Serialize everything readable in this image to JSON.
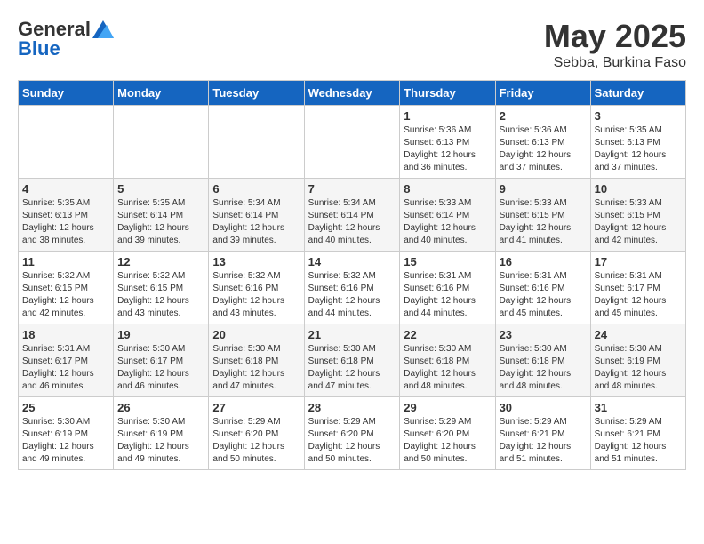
{
  "logo": {
    "general": "General",
    "blue": "Blue"
  },
  "title": "May 2025",
  "subtitle": "Sebba, Burkina Faso",
  "days_of_week": [
    "Sunday",
    "Monday",
    "Tuesday",
    "Wednesday",
    "Thursday",
    "Friday",
    "Saturday"
  ],
  "weeks": [
    [
      {
        "day": "",
        "info": ""
      },
      {
        "day": "",
        "info": ""
      },
      {
        "day": "",
        "info": ""
      },
      {
        "day": "",
        "info": ""
      },
      {
        "day": "1",
        "info": "Sunrise: 5:36 AM\nSunset: 6:13 PM\nDaylight: 12 hours\nand 36 minutes."
      },
      {
        "day": "2",
        "info": "Sunrise: 5:36 AM\nSunset: 6:13 PM\nDaylight: 12 hours\nand 37 minutes."
      },
      {
        "day": "3",
        "info": "Sunrise: 5:35 AM\nSunset: 6:13 PM\nDaylight: 12 hours\nand 37 minutes."
      }
    ],
    [
      {
        "day": "4",
        "info": "Sunrise: 5:35 AM\nSunset: 6:13 PM\nDaylight: 12 hours\nand 38 minutes."
      },
      {
        "day": "5",
        "info": "Sunrise: 5:35 AM\nSunset: 6:14 PM\nDaylight: 12 hours\nand 39 minutes."
      },
      {
        "day": "6",
        "info": "Sunrise: 5:34 AM\nSunset: 6:14 PM\nDaylight: 12 hours\nand 39 minutes."
      },
      {
        "day": "7",
        "info": "Sunrise: 5:34 AM\nSunset: 6:14 PM\nDaylight: 12 hours\nand 40 minutes."
      },
      {
        "day": "8",
        "info": "Sunrise: 5:33 AM\nSunset: 6:14 PM\nDaylight: 12 hours\nand 40 minutes."
      },
      {
        "day": "9",
        "info": "Sunrise: 5:33 AM\nSunset: 6:15 PM\nDaylight: 12 hours\nand 41 minutes."
      },
      {
        "day": "10",
        "info": "Sunrise: 5:33 AM\nSunset: 6:15 PM\nDaylight: 12 hours\nand 42 minutes."
      }
    ],
    [
      {
        "day": "11",
        "info": "Sunrise: 5:32 AM\nSunset: 6:15 PM\nDaylight: 12 hours\nand 42 minutes."
      },
      {
        "day": "12",
        "info": "Sunrise: 5:32 AM\nSunset: 6:15 PM\nDaylight: 12 hours\nand 43 minutes."
      },
      {
        "day": "13",
        "info": "Sunrise: 5:32 AM\nSunset: 6:16 PM\nDaylight: 12 hours\nand 43 minutes."
      },
      {
        "day": "14",
        "info": "Sunrise: 5:32 AM\nSunset: 6:16 PM\nDaylight: 12 hours\nand 44 minutes."
      },
      {
        "day": "15",
        "info": "Sunrise: 5:31 AM\nSunset: 6:16 PM\nDaylight: 12 hours\nand 44 minutes."
      },
      {
        "day": "16",
        "info": "Sunrise: 5:31 AM\nSunset: 6:16 PM\nDaylight: 12 hours\nand 45 minutes."
      },
      {
        "day": "17",
        "info": "Sunrise: 5:31 AM\nSunset: 6:17 PM\nDaylight: 12 hours\nand 45 minutes."
      }
    ],
    [
      {
        "day": "18",
        "info": "Sunrise: 5:31 AM\nSunset: 6:17 PM\nDaylight: 12 hours\nand 46 minutes."
      },
      {
        "day": "19",
        "info": "Sunrise: 5:30 AM\nSunset: 6:17 PM\nDaylight: 12 hours\nand 46 minutes."
      },
      {
        "day": "20",
        "info": "Sunrise: 5:30 AM\nSunset: 6:18 PM\nDaylight: 12 hours\nand 47 minutes."
      },
      {
        "day": "21",
        "info": "Sunrise: 5:30 AM\nSunset: 6:18 PM\nDaylight: 12 hours\nand 47 minutes."
      },
      {
        "day": "22",
        "info": "Sunrise: 5:30 AM\nSunset: 6:18 PM\nDaylight: 12 hours\nand 48 minutes."
      },
      {
        "day": "23",
        "info": "Sunrise: 5:30 AM\nSunset: 6:18 PM\nDaylight: 12 hours\nand 48 minutes."
      },
      {
        "day": "24",
        "info": "Sunrise: 5:30 AM\nSunset: 6:19 PM\nDaylight: 12 hours\nand 48 minutes."
      }
    ],
    [
      {
        "day": "25",
        "info": "Sunrise: 5:30 AM\nSunset: 6:19 PM\nDaylight: 12 hours\nand 49 minutes."
      },
      {
        "day": "26",
        "info": "Sunrise: 5:30 AM\nSunset: 6:19 PM\nDaylight: 12 hours\nand 49 minutes."
      },
      {
        "day": "27",
        "info": "Sunrise: 5:29 AM\nSunset: 6:20 PM\nDaylight: 12 hours\nand 50 minutes."
      },
      {
        "day": "28",
        "info": "Sunrise: 5:29 AM\nSunset: 6:20 PM\nDaylight: 12 hours\nand 50 minutes."
      },
      {
        "day": "29",
        "info": "Sunrise: 5:29 AM\nSunset: 6:20 PM\nDaylight: 12 hours\nand 50 minutes."
      },
      {
        "day": "30",
        "info": "Sunrise: 5:29 AM\nSunset: 6:21 PM\nDaylight: 12 hours\nand 51 minutes."
      },
      {
        "day": "31",
        "info": "Sunrise: 5:29 AM\nSunset: 6:21 PM\nDaylight: 12 hours\nand 51 minutes."
      }
    ]
  ]
}
